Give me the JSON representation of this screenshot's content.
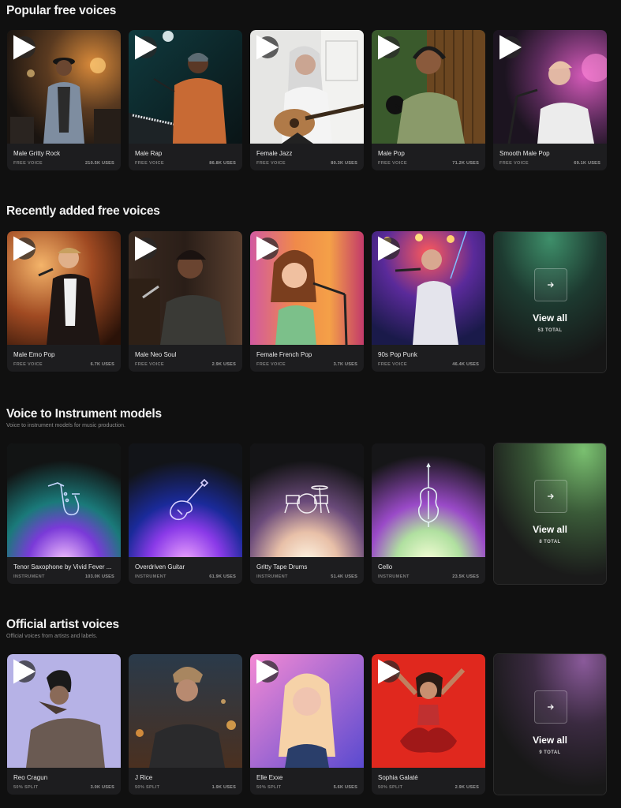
{
  "sections": [
    {
      "title": "Popular free voices",
      "subtitle": "",
      "cards": [
        {
          "name": "Male Gritty Rock",
          "meta": "FREE VOICE",
          "uses": "210.5K USES"
        },
        {
          "name": "Male Rap",
          "meta": "FREE VOICE",
          "uses": "86.8K USES"
        },
        {
          "name": "Female Jazz",
          "meta": "FREE VOICE",
          "uses": "80.3K USES"
        },
        {
          "name": "Male Pop",
          "meta": "FREE VOICE",
          "uses": "71.2K USES"
        },
        {
          "name": "Smooth Male Pop",
          "meta": "FREE VOICE",
          "uses": "69.1K USES"
        }
      ]
    },
    {
      "title": "Recently added free voices",
      "subtitle": "",
      "cards": [
        {
          "name": "Male Emo Pop",
          "meta": "FREE VOICE",
          "uses": "6.7K USES"
        },
        {
          "name": "Male Neo Soul",
          "meta": "FREE VOICE",
          "uses": "2.9K USES"
        },
        {
          "name": "Female French Pop",
          "meta": "FREE VOICE",
          "uses": "3.7K USES"
        },
        {
          "name": "90s Pop Punk",
          "meta": "FREE VOICE",
          "uses": "46.4K USES"
        }
      ],
      "view_all": {
        "label": "View all",
        "total": "53 TOTAL"
      }
    },
    {
      "title": "Voice to Instrument models",
      "subtitle": "Voice to instrument models for music production.",
      "cards": [
        {
          "name": "Tenor Saxophone by Vivid Fever ...",
          "meta": "INSTRUMENT",
          "uses": "103.0K USES"
        },
        {
          "name": "Overdriven Guitar",
          "meta": "INSTRUMENT",
          "uses": "61.9K USES"
        },
        {
          "name": "Gritty Tape Drums",
          "meta": "INSTRUMENT",
          "uses": "51.4K USES"
        },
        {
          "name": "Cello",
          "meta": "INSTRUMENT",
          "uses": "23.5K USES"
        }
      ],
      "view_all": {
        "label": "View all",
        "total": "8 TOTAL"
      }
    },
    {
      "title": "Official artist voices",
      "subtitle": "Official voices from artists and labels.",
      "cards": [
        {
          "name": "Reo Cragun",
          "meta": "50% SPLIT",
          "uses": "3.0K USES"
        },
        {
          "name": "J Rice",
          "meta": "50% SPLIT",
          "uses": "1.9K USES"
        },
        {
          "name": "Elle Exxe",
          "meta": "50% SPLIT",
          "uses": "5.6K USES"
        },
        {
          "name": "Sophia Galaté",
          "meta": "50% SPLIT",
          "uses": "2.9K USES"
        }
      ],
      "view_all": {
        "label": "View all",
        "total": "9 TOTAL"
      }
    }
  ],
  "colors": {
    "background": "#101010",
    "card": "#1d1d1f",
    "muted_text": "#7d7d7d"
  },
  "icons": [
    "play-icon",
    "arrow-right-icon",
    "saxophone-icon",
    "electric-guitar-icon",
    "drum-kit-icon",
    "cello-icon"
  ]
}
